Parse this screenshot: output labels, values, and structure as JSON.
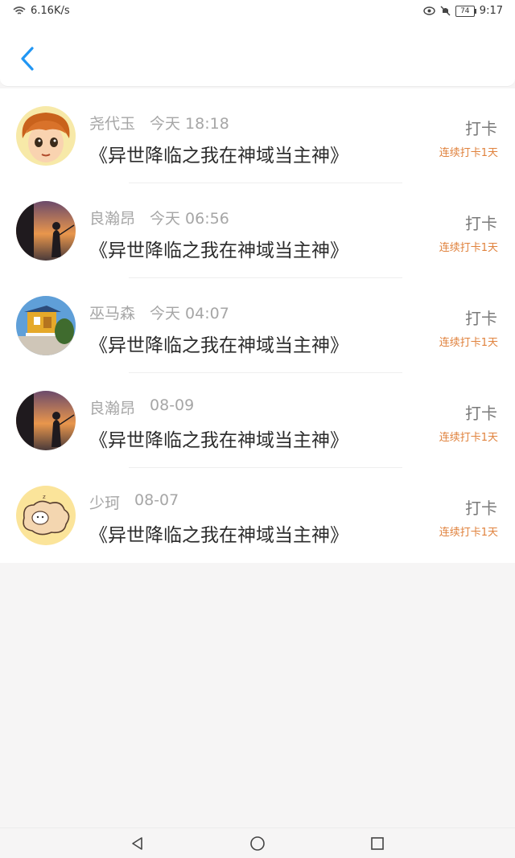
{
  "status_bar": {
    "net_speed": "6.16K/s",
    "battery": "74",
    "time": "9:17"
  },
  "header": {
    "back_icon": "chevron-left-icon",
    "accent_color": "#2196f3"
  },
  "checkins": [
    {
      "user": "尧代玉",
      "time": "今天 18:18",
      "book": "《异世降临之我在神域当主神》",
      "action": "打卡",
      "streak": "连续打卡1天",
      "avatar": "anime-boy"
    },
    {
      "user": "良瀚昂",
      "time": "今天 06:56",
      "book": "《异世降临之我在神域当主神》",
      "action": "打卡",
      "streak": "连续打卡1天",
      "avatar": "sunset-fishing"
    },
    {
      "user": "巫马森",
      "time": "今天 04:07",
      "book": "《异世降临之我在神域当主神》",
      "action": "打卡",
      "streak": "连续打卡1天",
      "avatar": "lifeguard-tower"
    },
    {
      "user": "良瀚昂",
      "time": "08-09",
      "book": "《异世降临之我在神域当主神》",
      "action": "打卡",
      "streak": "连续打卡1天",
      "avatar": "sunset-fishing"
    },
    {
      "user": "少珂",
      "time": "08-07",
      "book": "《异世降临之我在神域当主神》",
      "action": "打卡",
      "streak": "连续打卡1天",
      "avatar": "cartoon-dog"
    }
  ],
  "nav": {
    "back": "triangle-back-icon",
    "home": "circle-home-icon",
    "recent": "square-recents-icon"
  }
}
